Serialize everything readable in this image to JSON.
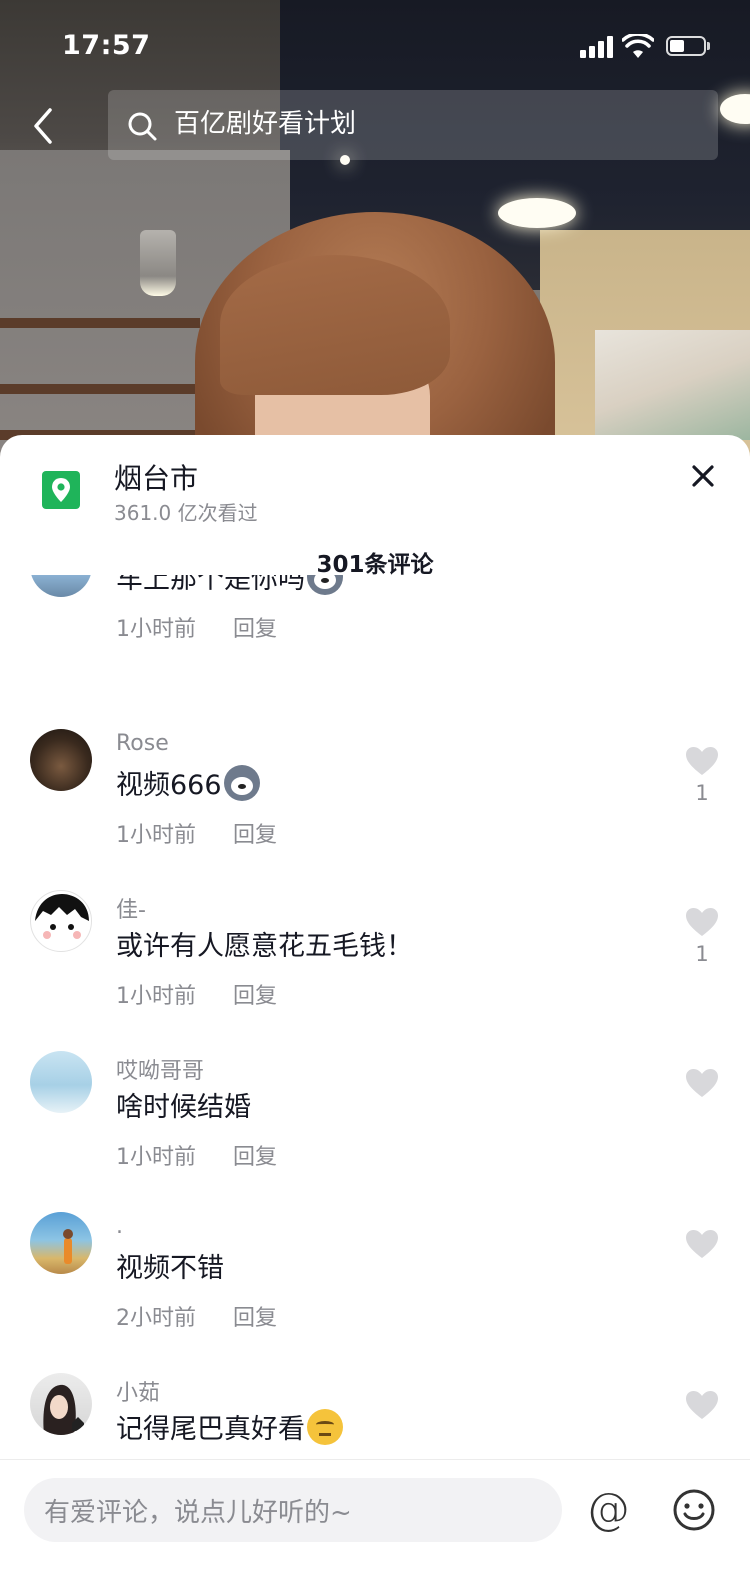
{
  "status_bar": {
    "time": "17:57"
  },
  "search": {
    "query": "百亿剧好看计划"
  },
  "location": {
    "title": "烟台市",
    "views": "361.0 亿次看过"
  },
  "comments_header": {
    "count_label": "301条评论"
  },
  "comments": [
    {
      "username": "",
      "text": "车上那个是你吗",
      "emoji": "dog",
      "time": "1小时前",
      "reply_label": "回复",
      "likes": ""
    },
    {
      "username": "Rose",
      "text": "视频666",
      "emoji": "dog",
      "time": "1小时前",
      "reply_label": "回复",
      "likes": "1"
    },
    {
      "username": "佳-",
      "text": "或许有人愿意花五毛钱！",
      "emoji": "",
      "time": "1小时前",
      "reply_label": "回复",
      "likes": "1"
    },
    {
      "username": "哎呦哥哥",
      "text": "啥时候结婚",
      "emoji": "",
      "time": "1小时前",
      "reply_label": "回复",
      "likes": ""
    },
    {
      "username": ".",
      "text": "视频不错",
      "emoji": "",
      "time": "2小时前",
      "reply_label": "回复",
      "likes": ""
    },
    {
      "username": "小茹",
      "text": "记得尾巴真好看",
      "emoji": "think",
      "time": "",
      "reply_label": "",
      "likes": ""
    }
  ],
  "input": {
    "placeholder": "有爱评论，说点儿好听的~"
  },
  "icons": {
    "back": "chevron-left-icon",
    "search": "search-icon",
    "location": "location-pin-icon",
    "close": "close-icon",
    "like": "heart-icon",
    "mention": "at-icon",
    "emoji": "smiley-icon"
  },
  "colors": {
    "location_green": "#1fb45a",
    "text_primary": "#161823",
    "text_secondary": "#8a8b91",
    "heart_gray": "#d8d8db"
  }
}
